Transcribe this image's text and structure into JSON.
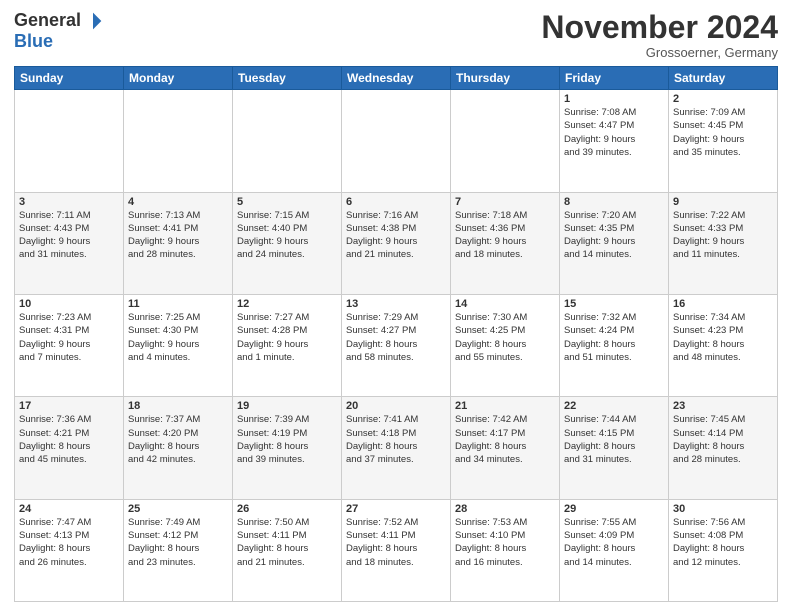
{
  "header": {
    "logo_general": "General",
    "logo_blue": "Blue",
    "month": "November 2024",
    "location": "Grossoerner, Germany"
  },
  "weekdays": [
    "Sunday",
    "Monday",
    "Tuesday",
    "Wednesday",
    "Thursday",
    "Friday",
    "Saturday"
  ],
  "weeks": [
    [
      {
        "day": "",
        "info": ""
      },
      {
        "day": "",
        "info": ""
      },
      {
        "day": "",
        "info": ""
      },
      {
        "day": "",
        "info": ""
      },
      {
        "day": "",
        "info": ""
      },
      {
        "day": "1",
        "info": "Sunrise: 7:08 AM\nSunset: 4:47 PM\nDaylight: 9 hours\nand 39 minutes."
      },
      {
        "day": "2",
        "info": "Sunrise: 7:09 AM\nSunset: 4:45 PM\nDaylight: 9 hours\nand 35 minutes."
      }
    ],
    [
      {
        "day": "3",
        "info": "Sunrise: 7:11 AM\nSunset: 4:43 PM\nDaylight: 9 hours\nand 31 minutes."
      },
      {
        "day": "4",
        "info": "Sunrise: 7:13 AM\nSunset: 4:41 PM\nDaylight: 9 hours\nand 28 minutes."
      },
      {
        "day": "5",
        "info": "Sunrise: 7:15 AM\nSunset: 4:40 PM\nDaylight: 9 hours\nand 24 minutes."
      },
      {
        "day": "6",
        "info": "Sunrise: 7:16 AM\nSunset: 4:38 PM\nDaylight: 9 hours\nand 21 minutes."
      },
      {
        "day": "7",
        "info": "Sunrise: 7:18 AM\nSunset: 4:36 PM\nDaylight: 9 hours\nand 18 minutes."
      },
      {
        "day": "8",
        "info": "Sunrise: 7:20 AM\nSunset: 4:35 PM\nDaylight: 9 hours\nand 14 minutes."
      },
      {
        "day": "9",
        "info": "Sunrise: 7:22 AM\nSunset: 4:33 PM\nDaylight: 9 hours\nand 11 minutes."
      }
    ],
    [
      {
        "day": "10",
        "info": "Sunrise: 7:23 AM\nSunset: 4:31 PM\nDaylight: 9 hours\nand 7 minutes."
      },
      {
        "day": "11",
        "info": "Sunrise: 7:25 AM\nSunset: 4:30 PM\nDaylight: 9 hours\nand 4 minutes."
      },
      {
        "day": "12",
        "info": "Sunrise: 7:27 AM\nSunset: 4:28 PM\nDaylight: 9 hours\nand 1 minute."
      },
      {
        "day": "13",
        "info": "Sunrise: 7:29 AM\nSunset: 4:27 PM\nDaylight: 8 hours\nand 58 minutes."
      },
      {
        "day": "14",
        "info": "Sunrise: 7:30 AM\nSunset: 4:25 PM\nDaylight: 8 hours\nand 55 minutes."
      },
      {
        "day": "15",
        "info": "Sunrise: 7:32 AM\nSunset: 4:24 PM\nDaylight: 8 hours\nand 51 minutes."
      },
      {
        "day": "16",
        "info": "Sunrise: 7:34 AM\nSunset: 4:23 PM\nDaylight: 8 hours\nand 48 minutes."
      }
    ],
    [
      {
        "day": "17",
        "info": "Sunrise: 7:36 AM\nSunset: 4:21 PM\nDaylight: 8 hours\nand 45 minutes."
      },
      {
        "day": "18",
        "info": "Sunrise: 7:37 AM\nSunset: 4:20 PM\nDaylight: 8 hours\nand 42 minutes."
      },
      {
        "day": "19",
        "info": "Sunrise: 7:39 AM\nSunset: 4:19 PM\nDaylight: 8 hours\nand 39 minutes."
      },
      {
        "day": "20",
        "info": "Sunrise: 7:41 AM\nSunset: 4:18 PM\nDaylight: 8 hours\nand 37 minutes."
      },
      {
        "day": "21",
        "info": "Sunrise: 7:42 AM\nSunset: 4:17 PM\nDaylight: 8 hours\nand 34 minutes."
      },
      {
        "day": "22",
        "info": "Sunrise: 7:44 AM\nSunset: 4:15 PM\nDaylight: 8 hours\nand 31 minutes."
      },
      {
        "day": "23",
        "info": "Sunrise: 7:45 AM\nSunset: 4:14 PM\nDaylight: 8 hours\nand 28 minutes."
      }
    ],
    [
      {
        "day": "24",
        "info": "Sunrise: 7:47 AM\nSunset: 4:13 PM\nDaylight: 8 hours\nand 26 minutes."
      },
      {
        "day": "25",
        "info": "Sunrise: 7:49 AM\nSunset: 4:12 PM\nDaylight: 8 hours\nand 23 minutes."
      },
      {
        "day": "26",
        "info": "Sunrise: 7:50 AM\nSunset: 4:11 PM\nDaylight: 8 hours\nand 21 minutes."
      },
      {
        "day": "27",
        "info": "Sunrise: 7:52 AM\nSunset: 4:11 PM\nDaylight: 8 hours\nand 18 minutes."
      },
      {
        "day": "28",
        "info": "Sunrise: 7:53 AM\nSunset: 4:10 PM\nDaylight: 8 hours\nand 16 minutes."
      },
      {
        "day": "29",
        "info": "Sunrise: 7:55 AM\nSunset: 4:09 PM\nDaylight: 8 hours\nand 14 minutes."
      },
      {
        "day": "30",
        "info": "Sunrise: 7:56 AM\nSunset: 4:08 PM\nDaylight: 8 hours\nand 12 minutes."
      }
    ]
  ]
}
